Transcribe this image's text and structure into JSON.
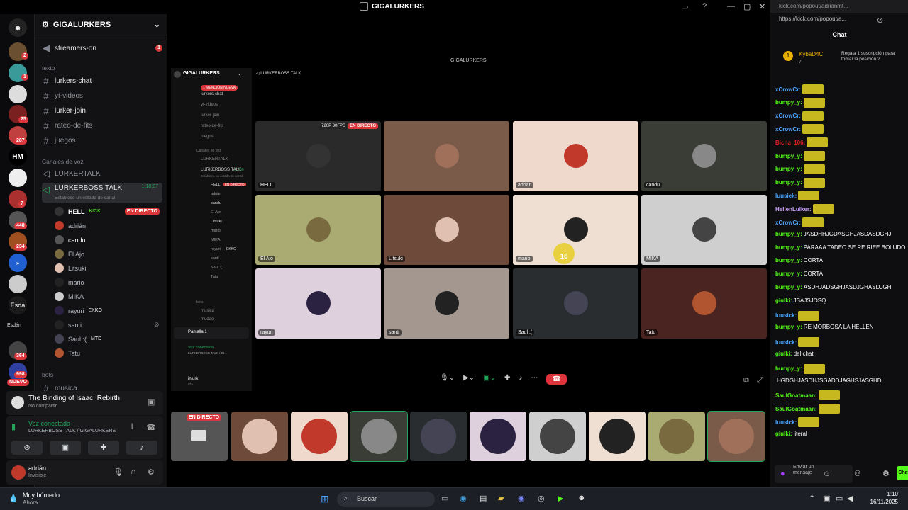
{
  "window": {
    "title": "GIGALURKERS"
  },
  "rail": {
    "badges": [
      "2",
      "1",
      "1",
      "25",
      "287",
      "64",
      "7",
      "448",
      "234",
      "Esda",
      "Esdán",
      "364",
      "998",
      "NUEVO"
    ]
  },
  "sidebar": {
    "server_name": "GIGALURKERS",
    "streamers_on": "streamers-on",
    "streamers_badge": "1",
    "cat_text": "texto",
    "channels": [
      "lurkers-chat",
      "yt-videos",
      "lurker-join",
      "rateo-de-fits",
      "juegos"
    ],
    "cat_voice": "Canales de voz",
    "voice1": "LURKERTALK",
    "voice2": "LURKERBOSS TALK",
    "voice2_time": "1:18:07",
    "voice2_status": "Establece un estado de canal",
    "users": [
      {
        "name": "HELL",
        "tag": "KICK",
        "live": "EN DIRECTO"
      },
      {
        "name": "adrián"
      },
      {
        "name": "candu"
      },
      {
        "name": "El Ajo"
      },
      {
        "name": "Litsuki"
      },
      {
        "name": "mario"
      },
      {
        "name": "MIKA"
      },
      {
        "name": "rayuri",
        "tag": "EKKO"
      },
      {
        "name": "santi"
      },
      {
        "name": "Saul :(",
        "tag": "MTD"
      },
      {
        "name": "Tatu"
      }
    ],
    "cat_bots": "bots",
    "bot_channel": "musica"
  },
  "activity": {
    "title": "The Binding of Isaac: Rebirth",
    "sub": "No compartir"
  },
  "voice": {
    "status": "Voz conectada",
    "path": "LURKERBOSS TALK / GIGALURKERS"
  },
  "user": {
    "name": "adrián",
    "status": "Invisible"
  },
  "nested": {
    "title": "GIGALURKERS",
    "server": "GIGALURKERS",
    "channel": "LURKERBOSS TALK",
    "mention": "1 MENCIÓN NUEVA",
    "channels": [
      "lurkers-chat",
      "yt-videos",
      "lurker-join",
      "rateo-de-fits",
      "juegos"
    ],
    "cat_voice": "Canales de voz",
    "voice1": "LURKERTALK",
    "voice2": "LURKERBOSS TALK",
    "voice2_time": "1:17:56",
    "voice2_status": "Establece un estado de canal",
    "users": [
      "HELL",
      "adrián",
      "candu",
      "El Ajo",
      "Litsuki",
      "mario",
      "MIKA",
      "rayuri",
      "santi",
      "Saul :(",
      "Tatu"
    ],
    "hell_live": "EN DIRECTO",
    "rayuri_tag": "EKKO",
    "cat_bots": "bots",
    "bot_channel": "musica",
    "bot_channel2": "mudae",
    "screen": "Pantalla 1",
    "voice_status": "Voz conectada",
    "voice_path": "LURKERBOSS TALK / GI...",
    "user": "inlurk",
    "user_status": "Cla..."
  },
  "tiles": [
    {
      "label": "HELL",
      "color": "#2a2a2a",
      "face": "#333",
      "live": "EN DIRECTO",
      "quality": "720P 30FPS"
    },
    {
      "label": "",
      "color": "#7a5b4a",
      "face": "#a0705a"
    },
    {
      "label": "adrián",
      "color": "#efd8cc",
      "face": "#c0392b"
    },
    {
      "label": "candu",
      "color": "#3a3d36",
      "face": "#888"
    },
    {
      "label": "El Ajo",
      "color": "#a9ab72",
      "face": "#7a6a40"
    },
    {
      "label": "Litsuki",
      "color": "#6e4a3a",
      "face": "#e0c0b0"
    },
    {
      "label": "mario",
      "color": "#efdfd3",
      "face": "#222"
    },
    {
      "label": "MIKA",
      "color": "#cfcfcf",
      "face": "#444"
    },
    {
      "label": "rayuri",
      "color": "#ded0dc",
      "face": "#2a2240"
    },
    {
      "label": "santi",
      "color": "#a39790",
      "face": "#222"
    },
    {
      "label": "Saul :(",
      "color": "#2a2d30",
      "face": "#445"
    },
    {
      "label": "Tatu",
      "color": "#4a2420",
      "face": "#b05530"
    }
  ],
  "mario_overlay": "16",
  "strip": {
    "live": "EN DIRECTO"
  },
  "chat": {
    "url": "kick.com/popout/adrianmt...",
    "addr": "https://kick.com/popout/a...",
    "title": "Chat",
    "gifter": "KybaD4C",
    "gift_count": "7",
    "gift_text": "Regala 1 suscripción para tomar la posición 2",
    "messages": [
      {
        "name": "xCrowCr:",
        "color": "#4aa3ff",
        "text": ""
      },
      {
        "name": "bumpy_y:",
        "color": "#53fc18",
        "text": ""
      },
      {
        "name": "xCrowCr:",
        "color": "#4aa3ff",
        "text": ""
      },
      {
        "name": "xCrowCr:",
        "color": "#4aa3ff",
        "text": ""
      },
      {
        "name": "Bicha_106:",
        "color": "#e02020",
        "text": ""
      },
      {
        "name": "bumpy_y:",
        "color": "#53fc18",
        "text": ""
      },
      {
        "name": "bumpy_y:",
        "color": "#53fc18",
        "text": ""
      },
      {
        "name": "bumpy_y:",
        "color": "#53fc18",
        "text": ""
      },
      {
        "name": "luusick:",
        "color": "#4aa3ff",
        "text": ""
      },
      {
        "name": "HellenLulker:",
        "color": "#c8a0ff",
        "text": ""
      },
      {
        "name": "xCrowCr:",
        "color": "#4aa3ff",
        "text": ""
      },
      {
        "name": "bumpy_y:",
        "color": "#53fc18",
        "text": "JASDHHJGDASGHJASDASDGHJ"
      },
      {
        "name": "bumpy_y:",
        "color": "#53fc18",
        "text": "PARAAA TADEO SE RE RIEE BOLUDO"
      },
      {
        "name": "bumpy_y:",
        "color": "#53fc18",
        "text": "CORTA"
      },
      {
        "name": "bumpy_y:",
        "color": "#53fc18",
        "text": "CORTA"
      },
      {
        "name": "bumpy_y:",
        "color": "#53fc18",
        "text": "ASDHJADSGHJASDJGHASDJGH"
      },
      {
        "name": "giulki:",
        "color": "#53fc18",
        "text": "JSAJSJOSQ"
      },
      {
        "name": "luusick:",
        "color": "#4aa3ff",
        "text": ""
      },
      {
        "name": "bumpy_y:",
        "color": "#53fc18",
        "text": "RE MORBOSA LA HELLEN"
      },
      {
        "name": "luusick:",
        "color": "#4aa3ff",
        "text": ""
      },
      {
        "name": "giulki:",
        "color": "#53fc18",
        "text": "del chat"
      },
      {
        "name": "bumpy_y:",
        "color": "#53fc18",
        "text": ""
      },
      {
        "name": "",
        "color": "#fff",
        "text": "HGDGHJASDHJSGADDJAGHSJASGHD"
      },
      {
        "name": "SaulGoatmaan:",
        "color": "#53fc18",
        "text": ""
      },
      {
        "name": "SaulGoatmaan:",
        "color": "#53fc18",
        "text": ""
      },
      {
        "name": "luusick:",
        "color": "#4aa3ff",
        "text": ""
      },
      {
        "name": "giulki:",
        "color": "#53fc18",
        "text": "literal"
      }
    ],
    "input_placeholder": "Enviar un mensaje",
    "send": "Chat"
  },
  "taskbar": {
    "weather": "Muy húmedo",
    "weather_sub": "Ahora",
    "search": "Buscar",
    "time": "1:10",
    "date": "16/11/2025"
  }
}
